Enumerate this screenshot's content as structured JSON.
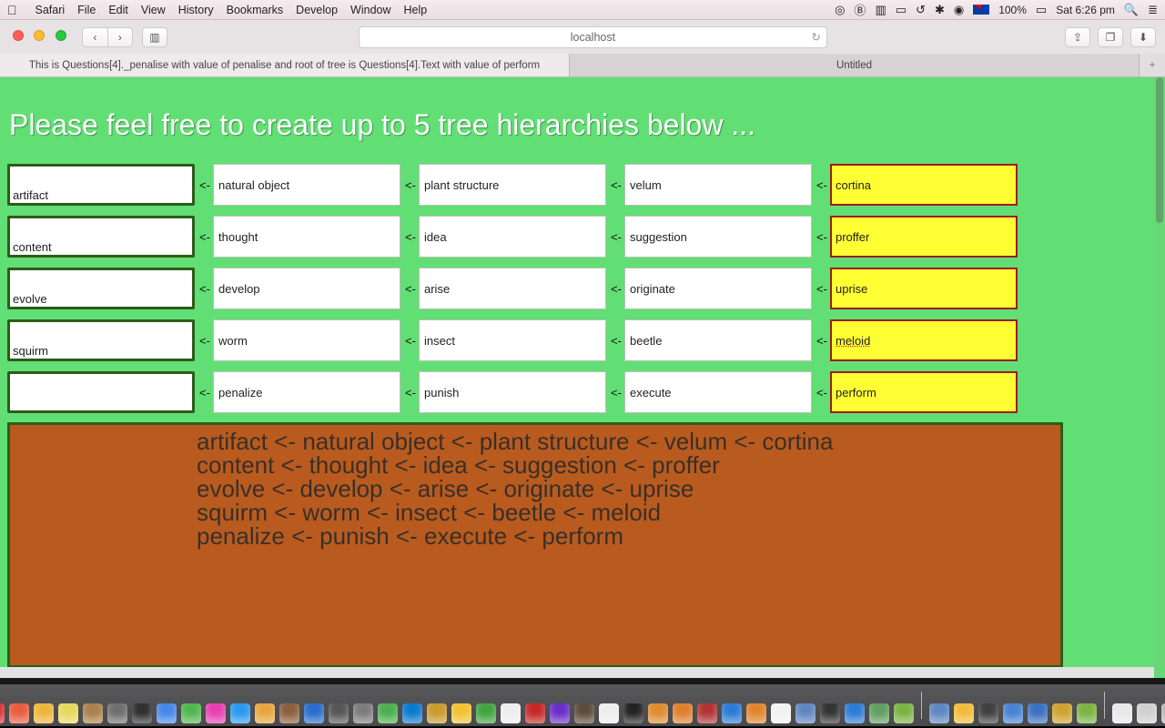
{
  "menubar": {
    "app": "Safari",
    "items": [
      "File",
      "Edit",
      "View",
      "History",
      "Bookmarks",
      "Develop",
      "Window",
      "Help"
    ],
    "battery": "100%",
    "clock": "Sat 6:26 pm"
  },
  "toolbar": {
    "address": "localhost"
  },
  "tabs": {
    "active": "This is Questions[4]._penalise with value of penalise and root of tree is Questions[4].Text with value of perform",
    "second": "Untitled"
  },
  "page": {
    "heading": "Please feel free to create up to 5 tree hierarchies below ...",
    "arrow": "<-",
    "rows": [
      {
        "root": "artifact",
        "c1": "natural object",
        "c2": "plant structure",
        "c3": "velum",
        "last": "cortina"
      },
      {
        "root": "content",
        "c1": "thought",
        "c2": "idea",
        "c3": "suggestion",
        "last": "proffer"
      },
      {
        "root": "evolve",
        "c1": "develop",
        "c2": "arise",
        "c3": "originate",
        "last": "uprise"
      },
      {
        "root": "squirm",
        "c1": "worm",
        "c2": "insect",
        "c3": "beetle",
        "last": "meloid"
      },
      {
        "root": "",
        "c1": "penalize",
        "c2": "punish",
        "c3": "execute",
        "last": "perform"
      }
    ],
    "output": [
      "artifact <- natural object <- plant structure <- velum <-  cortina",
      "content <- thought <- idea <- suggestion <- proffer",
      "evolve <- develop <- arise <- originate <- uprise",
      "squirm <- worm <- insect <- beetle <- meloid",
      " penalize <-  punish <-  execute <- perform"
    ]
  }
}
